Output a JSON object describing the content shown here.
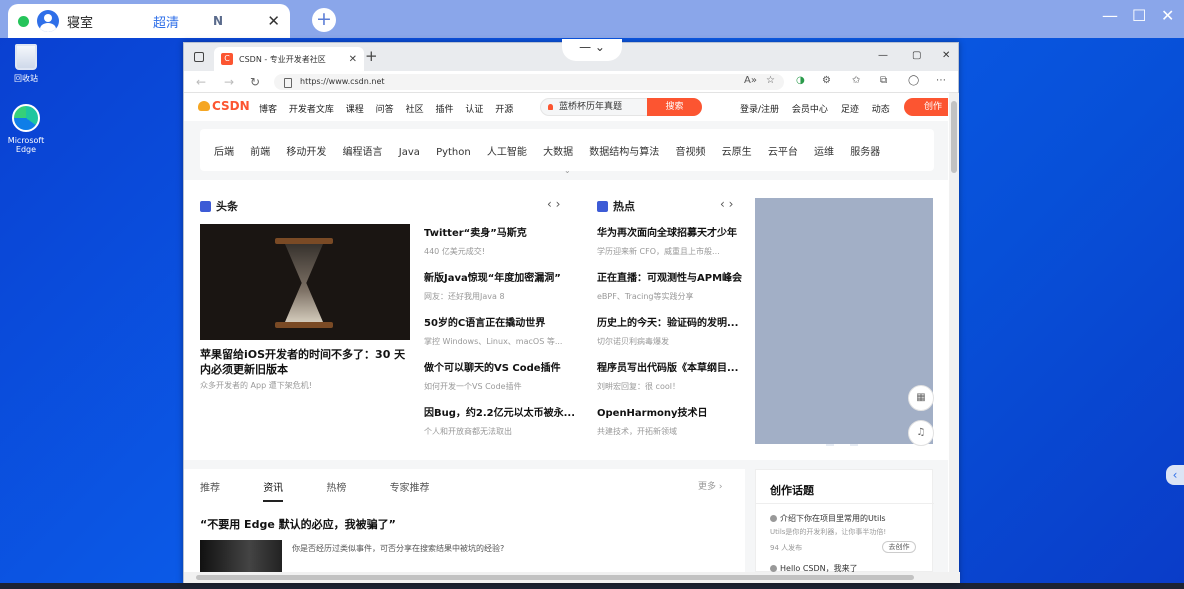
{
  "remote": {
    "device_name": "寝室",
    "quality": "超清",
    "mode": "N",
    "close": "✕",
    "add": "+",
    "min": "—",
    "max": "☐",
    "close_win": "✕"
  },
  "desktop": {
    "icons": [
      {
        "label": "回收站"
      },
      {
        "label": "Microsoft Edge"
      }
    ]
  },
  "browser": {
    "tab_title": "CSDN - 专业开发者社区",
    "tab_close": "✕",
    "new_tab": "+",
    "handle": "— ⌄",
    "url": "https://www.csdn.net",
    "min": "—",
    "max": "▢",
    "close": "✕",
    "nav_back": "←",
    "nav_fwd": "→",
    "reload": "↻",
    "toolbar": [
      "A»",
      "☆",
      "◑",
      "⚙",
      "✩",
      "⧉",
      "◯",
      "⋯"
    ]
  },
  "csdn": {
    "logo": "CSDN",
    "nav": [
      "博客",
      "开发者文库",
      "课程",
      "问答",
      "社区",
      "插件",
      "认证",
      "开源"
    ],
    "search_placeholder": "蓝桥杯历年真题",
    "search_button": "搜索",
    "right_links": [
      "登录/注册",
      "会员中心",
      "足迹",
      "动态"
    ],
    "create_button": "创作",
    "categories": [
      "后端",
      "前端",
      "移动开发",
      "编程语言",
      "Java",
      "Python",
      "人工智能",
      "大数据",
      "数据结构与算法",
      "音视频",
      "云原生",
      "云平台",
      "运维",
      "服务器"
    ],
    "headlines": {
      "heading": "头条",
      "hero_title": "苹果留给iOS开发者的时间不多了：30 天内必须更新旧版本",
      "hero_sub": "众多开发者的 App 遭下架危机!",
      "items": [
        {
          "title": "Twitter“卖身”马斯克",
          "sub": "440 亿美元成交!"
        },
        {
          "title": "新版Java惊现“年度加密漏洞”",
          "sub": "网友：还好我用Java 8"
        },
        {
          "title": "50岁的C语言正在撬动世界",
          "sub": "掌控 Windows、Linux、macOS 等..."
        },
        {
          "title": "做个可以聊天的VS Code插件",
          "sub": "如何开发一个VS Code插件"
        },
        {
          "title": "因Bug，约2.2亿元以太币被永...",
          "sub": "个人和开放商都无法取出"
        }
      ]
    },
    "hot": {
      "heading": "热点",
      "items": [
        {
          "title": "华为再次面向全球招募天才少年",
          "sub": "学历迎来新 CFO，威重且上市般..."
        },
        {
          "title": "正在直播：可观测性与APM峰会",
          "sub": "eBPF、Tracing等实践分享"
        },
        {
          "title": "历史上的今天：验证码的发明...",
          "sub": "切尔诺贝利病毒爆发"
        },
        {
          "title": "程序员写出代码版《本草纲目...",
          "sub": "刘畊宏回复：很 cool！"
        },
        {
          "title": "OpenHarmony技术日",
          "sub": "共建技术，开拓新领域"
        }
      ]
    },
    "float_buttons": [
      "▦",
      "♫"
    ],
    "feed": {
      "tabs": [
        "推荐",
        "资讯",
        "热榜",
        "专家推荐"
      ],
      "active_tab": "资讯",
      "more": "更多 ›",
      "article_title": "“不要用 Edge 默认的必应，我被骗了”",
      "article_desc": "你是否经历过类似事件，可否分享在搜索结果中被坑的经验?"
    },
    "topics": {
      "heading": "创作话题",
      "items": [
        {
          "title": "介绍下你在项目里常用的Utils",
          "sub": "Utils是你的开发利器，让你事半功倍!",
          "meta": "94 人发布",
          "button": "去创作"
        },
        {
          "title": "Hello CSDN，我来了"
        }
      ]
    }
  }
}
